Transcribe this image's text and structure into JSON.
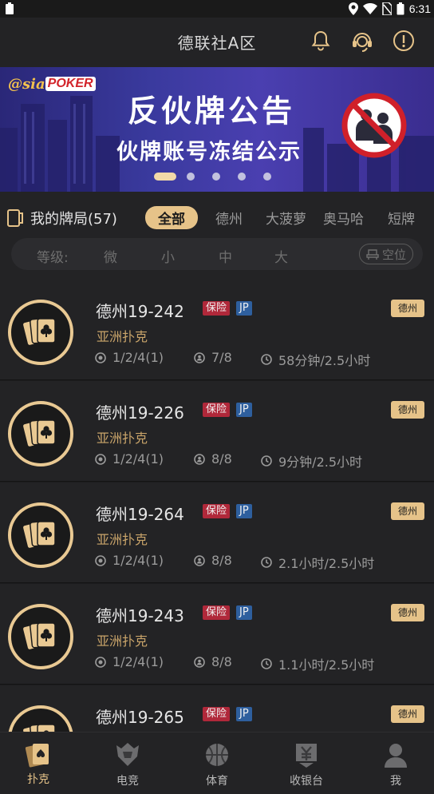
{
  "status": {
    "time": "6:31"
  },
  "header": {
    "title": "德联社A区"
  },
  "banner": {
    "logo_prefix": "@sia",
    "logo_brand": "POKER",
    "title": "反伙牌公告",
    "subtitle": "伙牌账号冻结公示",
    "slides": 5,
    "active_slide": 0
  },
  "tabs": {
    "my_tables": "我的牌局(57)",
    "categories": [
      "全部",
      "德州",
      "大菠萝",
      "奥马哈",
      "短牌"
    ],
    "active_category": 0,
    "level_label": "等级:",
    "levels": [
      "微",
      "小",
      "中",
      "大"
    ],
    "seat_label": "空位"
  },
  "games": [
    {
      "name": "德州19-242",
      "insurance": "保险",
      "jp": "JP",
      "club": "亚洲扑克",
      "blinds": "1/2/4(1)",
      "players": "7/8",
      "time": "58分钟/2.5小时",
      "tag": "德州"
    },
    {
      "name": "德州19-226",
      "insurance": "保险",
      "jp": "JP",
      "club": "亚洲扑克",
      "blinds": "1/2/4(1)",
      "players": "8/8",
      "time": "9分钟/2.5小时",
      "tag": "德州"
    },
    {
      "name": "德州19-264",
      "insurance": "保险",
      "jp": "JP",
      "club": "亚洲扑克",
      "blinds": "1/2/4(1)",
      "players": "8/8",
      "time": "2.1小时/2.5小时",
      "tag": "德州"
    },
    {
      "name": "德州19-243",
      "insurance": "保险",
      "jp": "JP",
      "club": "亚洲扑克",
      "blinds": "1/2/4(1)",
      "players": "8/8",
      "time": "1.1小时/2.5小时",
      "tag": "德州"
    },
    {
      "name": "德州19-265",
      "insurance": "保险",
      "jp": "JP",
      "club": "",
      "blinds": "",
      "players": "",
      "time": "",
      "tag": "德州"
    }
  ],
  "nav": [
    {
      "label": "扑克",
      "icon": "poker-icon",
      "active": true
    },
    {
      "label": "电竞",
      "icon": "esports-icon",
      "active": false
    },
    {
      "label": "体育",
      "icon": "basketball-icon",
      "active": false
    },
    {
      "label": "收银台",
      "icon": "cashier-icon",
      "active": false
    },
    {
      "label": "我",
      "icon": "profile-icon",
      "active": false
    }
  ],
  "colors": {
    "accent": "#e6c389",
    "insurance": "#b0283a",
    "jp": "#2e5f9e",
    "club_text": "#c9a46a"
  }
}
